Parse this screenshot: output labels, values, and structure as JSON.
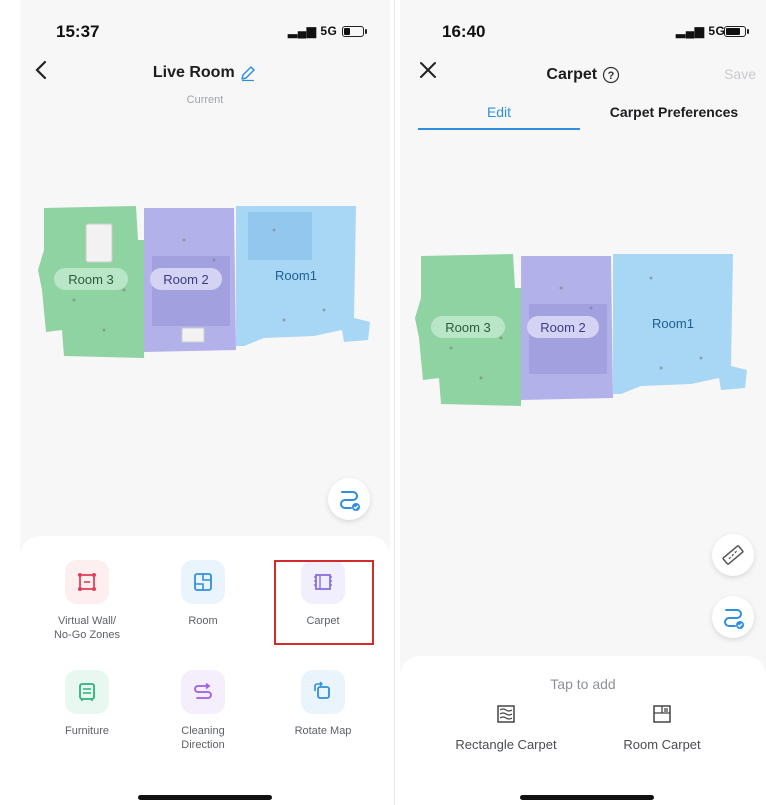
{
  "left": {
    "status": {
      "time": "15:37",
      "network": "5G"
    },
    "header": {
      "title": "Live Room",
      "subtitle": "Current"
    },
    "map": {
      "rooms": [
        {
          "label": "Room 3"
        },
        {
          "label": "Room 2"
        },
        {
          "label": "Room1"
        }
      ]
    },
    "tools": [
      {
        "label": "Virtual Wall/\nNo-Go Zones",
        "icon": "virtual-wall-icon"
      },
      {
        "label": "Room",
        "icon": "room-icon"
      },
      {
        "label": "Carpet",
        "icon": "carpet-icon"
      },
      {
        "label": "Furniture",
        "icon": "furniture-icon"
      },
      {
        "label": "Cleaning\nDirection",
        "icon": "cleaning-direction-icon"
      },
      {
        "label": "Rotate Map",
        "icon": "rotate-map-icon"
      }
    ]
  },
  "right": {
    "status": {
      "time": "16:40",
      "network": "5G"
    },
    "header": {
      "title": "Carpet",
      "save_label": "Save"
    },
    "tabs": [
      {
        "label": "Edit",
        "active": true
      },
      {
        "label": "Carpet Preferences",
        "active": false
      }
    ],
    "map": {
      "rooms": [
        {
          "label": "Room 3"
        },
        {
          "label": "Room 2"
        },
        {
          "label": "Room1"
        }
      ]
    },
    "sheet": {
      "hint": "Tap to add",
      "options": [
        {
          "label": "Rectangle Carpet",
          "icon": "rectangle-carpet-icon"
        },
        {
          "label": "Room Carpet",
          "icon": "room-carpet-icon"
        }
      ]
    }
  },
  "colors": {
    "accent": "#2f8fde",
    "highlight": "#d42a2a",
    "room3": "#8fd3a3",
    "room2": "#b3b1ea",
    "room1": "#a8d6f5"
  }
}
